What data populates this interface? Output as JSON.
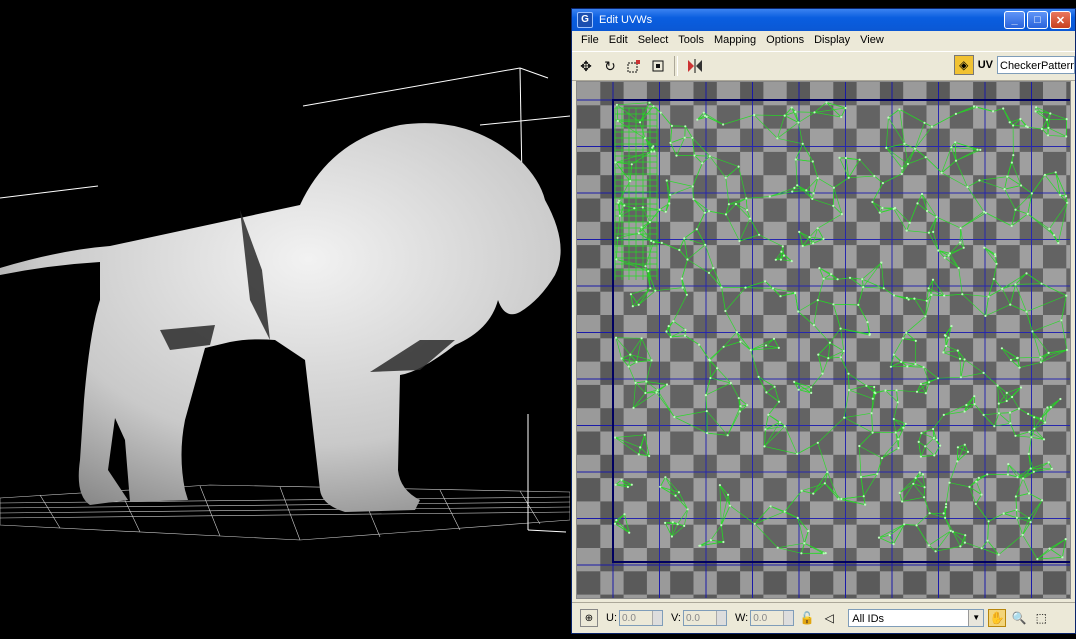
{
  "window": {
    "title": "Edit UVWs",
    "app_icon": "G",
    "minimize_icon": "minimize-icon",
    "maximize_icon": "maximize-icon",
    "close_icon": "close-icon"
  },
  "menu": [
    "File",
    "Edit",
    "Select",
    "Tools",
    "Mapping",
    "Options",
    "Display",
    "View"
  ],
  "toolbar": {
    "icons": [
      "move-icon",
      "rotate-icon",
      "scale-icon",
      "freeform-icon",
      "mirror-icon"
    ],
    "uv_label": "UV",
    "map_select": "CheckerPattern"
  },
  "statusbar": {
    "u_label": "U:",
    "u_value": "0.0",
    "v_label": "V:",
    "v_value": "0.0",
    "w_label": "W:",
    "w_value": "0.0",
    "id_filter": "All IDs"
  },
  "colors": {
    "uv_mesh": "#22dd22",
    "grid_lines": "#1a1aa8",
    "checker_dark": "#5a5a5a",
    "checker_light": "#9a9a9a",
    "titlebar": "#0b58d4"
  }
}
